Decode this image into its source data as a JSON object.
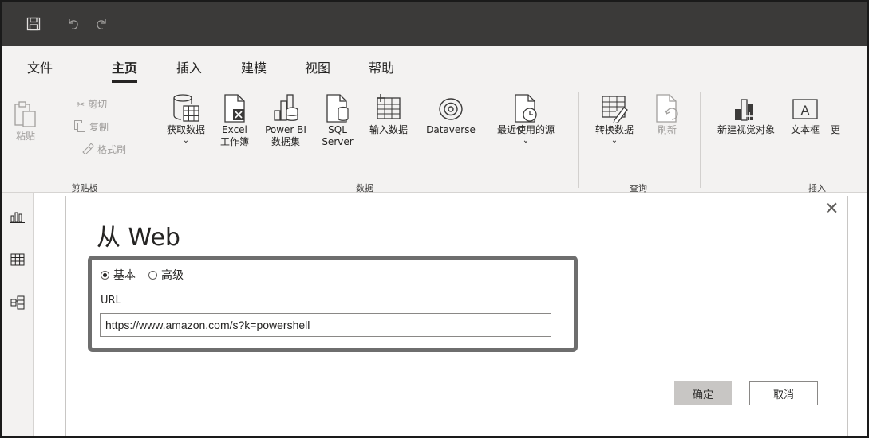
{
  "titlebar": {
    "qat": [
      "save-icon",
      "undo-icon",
      "redo-icon"
    ]
  },
  "tabs": [
    {
      "label": "文件"
    },
    {
      "label": "主页",
      "active": true
    },
    {
      "label": "插入"
    },
    {
      "label": "建模"
    },
    {
      "label": "视图"
    },
    {
      "label": "帮助"
    }
  ],
  "ribbon": {
    "clipboard": {
      "paste": "粘贴",
      "cut": "剪切",
      "copy": "复制",
      "format_painter": "格式刷",
      "group": "剪贴板"
    },
    "data": {
      "get_data": "获取数据",
      "excel_l1": "Excel",
      "excel_l2": "工作簿",
      "pbi_l1": "Power BI",
      "pbi_l2": "数据集",
      "sql_l1": "SQL",
      "sql_l2": "Server",
      "enter_data": "输入数据",
      "dataverse": "Dataverse",
      "recent": "最近使用的源",
      "group": "数据"
    },
    "query": {
      "transform": "转换数据",
      "refresh": "刷新",
      "group": "查询"
    },
    "insert": {
      "new_visual": "新建视觉对象",
      "text_box": "文本框",
      "more": "更",
      "group": "插入"
    }
  },
  "rail": [
    "report-view-icon",
    "data-view-icon",
    "model-view-icon"
  ],
  "dialog": {
    "title": "从 Web",
    "radio_basic": "基本",
    "radio_advanced": "高级",
    "selected": "基本",
    "url_label": "URL",
    "url_value": "https://www.amazon.com/s?k=powershell",
    "ok": "确定",
    "cancel": "取消"
  }
}
